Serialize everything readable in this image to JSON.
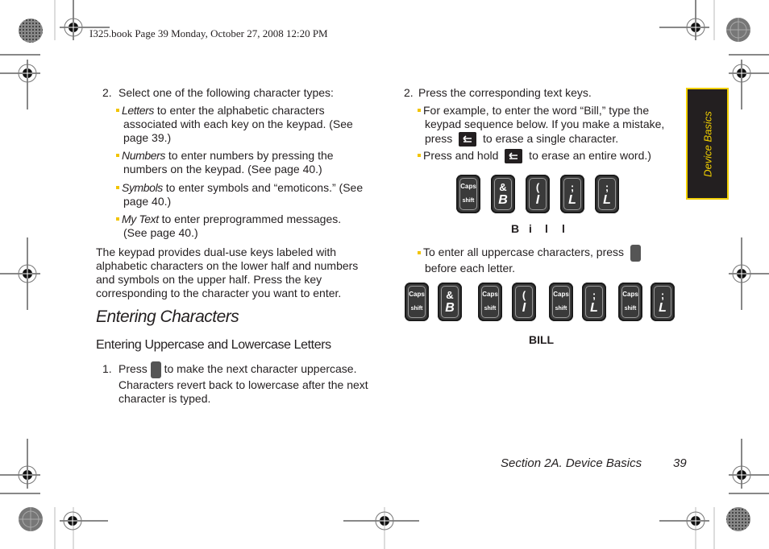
{
  "print_header": {
    "text": "I325.book  Page 39  Monday, October 27, 2008  12:20 PM"
  },
  "left_column": {
    "step2": {
      "number": "2.",
      "text": "Select one of the following character types:",
      "bullets": [
        {
          "term": "Letters",
          "lines": [
            " to enter the alphabetic characters",
            "associated with each key on the keypad. (See",
            "page 39.)"
          ]
        },
        {
          "term": "Numbers",
          "lines": [
            " to enter numbers by pressing the",
            "numbers on the keypad. (See page 40.)"
          ]
        },
        {
          "term": "Symbols",
          "lines": [
            " to enter symbols and “emoticons.” (See",
            "page 40.)"
          ]
        },
        {
          "term": "My Text",
          "lines": [
            " to enter preprogrammed messages.",
            "(See page 40.)"
          ]
        }
      ]
    },
    "paragraph": [
      "The keypad provides dual-use keys labeled with",
      "alphabetic characters on the lower half and numbers",
      "and symbols on the upper half. Press the key",
      "corresponding to the character you want to enter."
    ],
    "heading": "Entering Characters",
    "subheading": "Entering Uppercase and Lowercase Letters",
    "step1": {
      "number": "1.",
      "before_icon": "Press",
      "after_icon": " to make the next character uppercase.",
      "lines": [
        "Characters revert back to lowercase after the next",
        "character is typed."
      ],
      "icon": "caps-shift-key-icon"
    }
  },
  "right_column": {
    "step2": {
      "number": "2.",
      "text": "Press the corresponding text keys.",
      "bullet1": {
        "lines": [
          "For example, to enter the word “Bill,” type the",
          "keypad sequence below. If you make a mistake,"
        ],
        "press": "press",
        "after_icon": " to erase a single character.",
        "icon": "back-key-icon"
      },
      "bullet2": {
        "before_icon": "Press and hold",
        "after_icon": " to erase an entire word.)",
        "icon": "back-key-icon"
      }
    },
    "sequence1": {
      "keys": [
        {
          "top": "Caps",
          "bottom": "shift",
          "type": "caps"
        },
        {
          "top": "&",
          "bottom": "B",
          "type": "char"
        },
        {
          "top": "(",
          "bottom": "I",
          "type": "char"
        },
        {
          "top": ";",
          "bottom": "L",
          "type": "char"
        },
        {
          "top": ";",
          "bottom": "L",
          "type": "char"
        }
      ],
      "caption_letters": [
        "B",
        "i",
        "l",
        "l"
      ]
    },
    "bullet3": {
      "line1": "To enter all uppercase characters, press",
      "line2": "before each letter.",
      "icon": "caps-shift-key-icon"
    },
    "sequence2": {
      "keys": [
        {
          "top": "Caps",
          "bottom": "shift",
          "type": "caps"
        },
        {
          "top": "&",
          "bottom": "B",
          "type": "char"
        },
        {
          "top": "Caps",
          "bottom": "shift",
          "type": "caps"
        },
        {
          "top": "(",
          "bottom": "I",
          "type": "char"
        },
        {
          "top": "Caps",
          "bottom": "shift",
          "type": "caps"
        },
        {
          "top": ";",
          "bottom": "L",
          "type": "char"
        },
        {
          "top": "Caps",
          "bottom": "shift",
          "type": "caps"
        },
        {
          "top": ";",
          "bottom": "L",
          "type": "char"
        }
      ],
      "caption": "BILL"
    }
  },
  "side_tab": {
    "label": "Device Basics",
    "colors": {
      "background": "#231f20",
      "accent": "#f2d000"
    }
  },
  "footer": {
    "section": "Section 2A. Device Basics",
    "page_number": "39"
  }
}
